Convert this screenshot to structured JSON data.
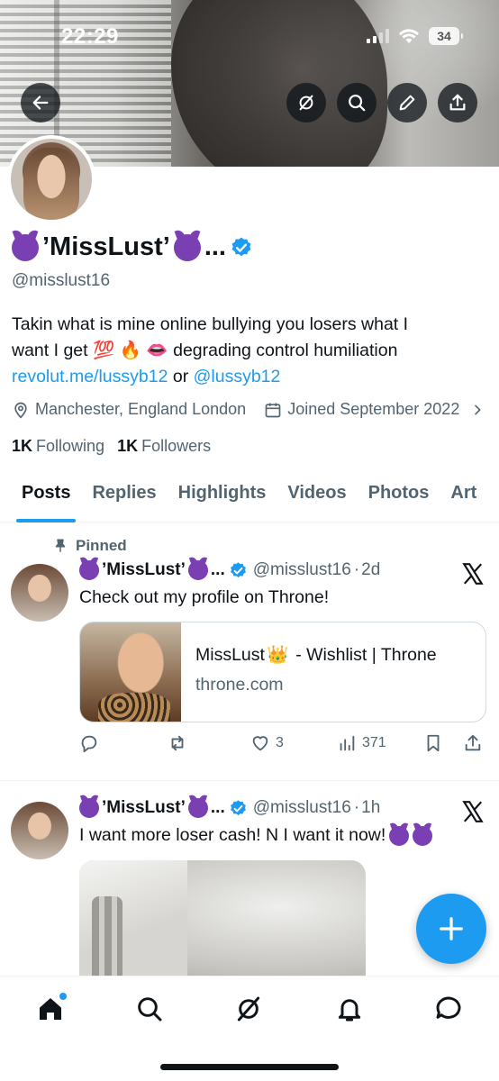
{
  "status_bar": {
    "time": "22:29",
    "battery": "34"
  },
  "header_buttons": [
    "back-arrow-icon",
    "grok-icon",
    "search-icon",
    "edit-icon",
    "share-icon"
  ],
  "profile": {
    "display_name": "’MissLust’",
    "display_name_suffix": "...",
    "handle": "@misslust16",
    "bio_line1": "Takin what is mine online bullying you losers what I",
    "bio_line2_text": "want I get",
    "bio_line2_emojis": "💯 🔥 👄",
    "bio_line2_rest": "degrading control humiliation",
    "bio_link1": "revolut.me/lussyb12",
    "bio_or": "or",
    "bio_link2": "@lussyb12",
    "location": "Manchester, England London",
    "joined": "Joined September 2022",
    "following_count": "1K",
    "following_label": "Following",
    "followers_count": "1K",
    "followers_label": "Followers"
  },
  "tabs": [
    {
      "label": "Posts",
      "active": true
    },
    {
      "label": "Replies"
    },
    {
      "label": "Highlights"
    },
    {
      "label": "Videos"
    },
    {
      "label": "Photos"
    },
    {
      "label": "Art"
    }
  ],
  "posts": [
    {
      "pinned_label": "Pinned",
      "name": "’MissLust’",
      "name_suffix": "...",
      "handle": "@misslust16",
      "time": "2d",
      "text": "Check out my profile on Throne!",
      "card_title_prefix": "MissLust",
      "card_title_emoji": "👑",
      "card_title_rest": "- Wishlist | Throne",
      "card_domain": "throne.com",
      "likes": "3",
      "views": "371"
    },
    {
      "name": "’MissLust’",
      "name_suffix": "...",
      "handle": "@misslust16",
      "time": "1h",
      "text": "I want more loser cash! N I want it now!"
    }
  ],
  "accent_color": "#1d9bf0",
  "bottom_nav": [
    "home-icon",
    "search-icon",
    "grok-icon",
    "notifications-icon",
    "messages-icon"
  ]
}
